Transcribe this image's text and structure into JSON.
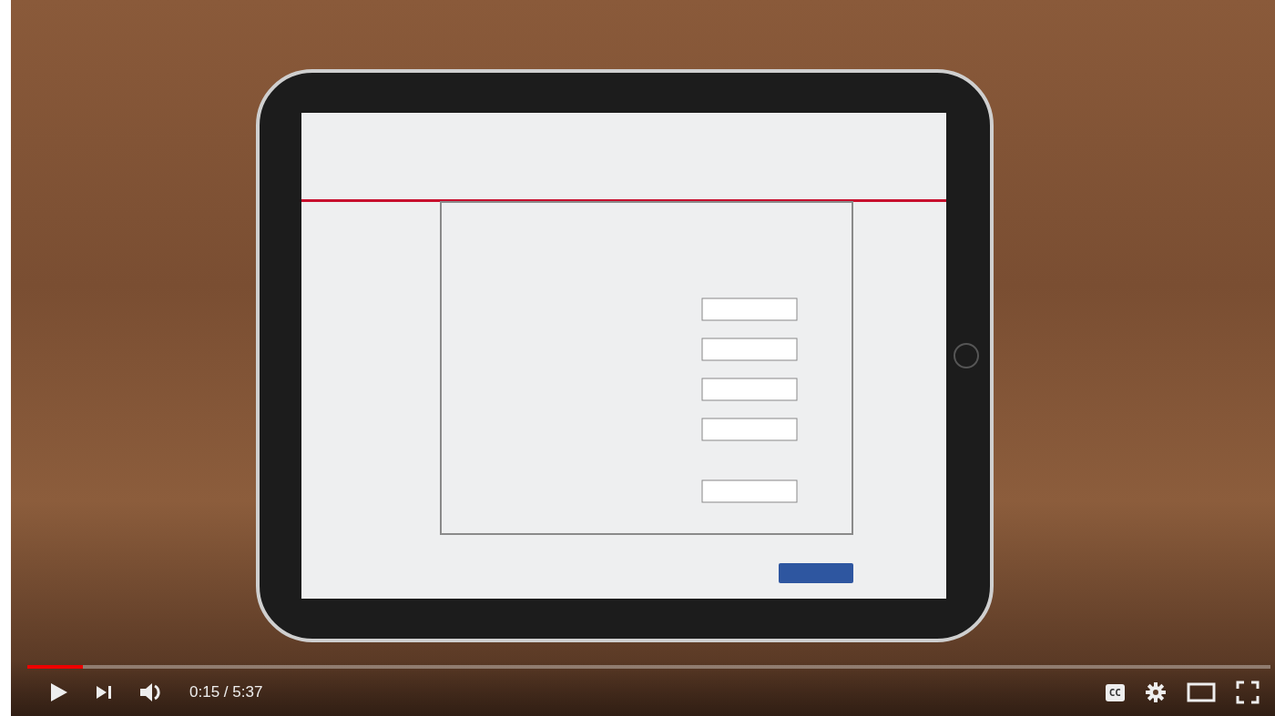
{
  "player": {
    "progress": {
      "level": 0.045
    },
    "time": "0:15 / 5:37",
    "captions_button": {
      "label": "CC"
    }
  }
}
